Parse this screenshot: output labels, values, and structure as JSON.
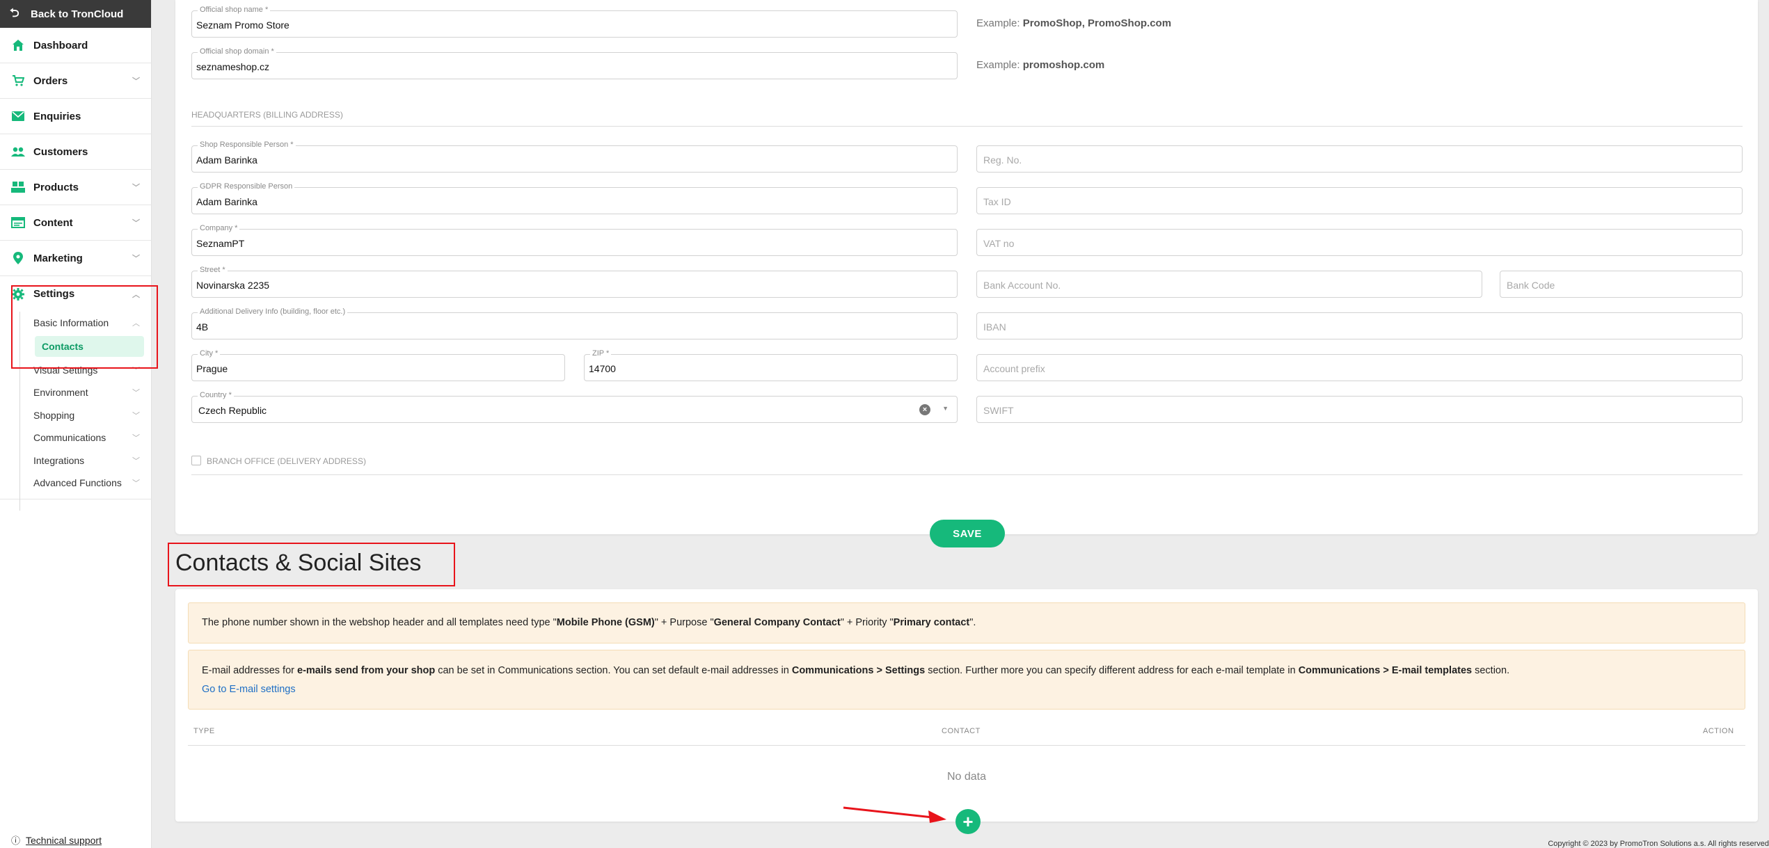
{
  "sidebar": {
    "back_label": "Back to TronCloud",
    "items": [
      {
        "label": "Dashboard",
        "icon": "home-icon"
      },
      {
        "label": "Orders",
        "icon": "cart-icon"
      },
      {
        "label": "Enquiries",
        "icon": "mail-icon"
      },
      {
        "label": "Customers",
        "icon": "users-icon"
      },
      {
        "label": "Products",
        "icon": "boxes-icon"
      },
      {
        "label": "Content",
        "icon": "layout-icon"
      },
      {
        "label": "Marketing",
        "icon": "pin-icon"
      },
      {
        "label": "Settings",
        "icon": "gear-icon"
      }
    ],
    "settings_sub": [
      {
        "label": "Basic Information"
      },
      {
        "label": "Visual Settings"
      },
      {
        "label": "Environment"
      },
      {
        "label": "Shopping"
      },
      {
        "label": "Communications"
      },
      {
        "label": "Integrations"
      },
      {
        "label": "Advanced Functions"
      }
    ],
    "active_sub": "Contacts",
    "support_label": "Technical support"
  },
  "form": {
    "shop_name": {
      "label": "Official shop name *",
      "value": "Seznam Promo Store"
    },
    "shop_name_example": {
      "prefix": "Example:",
      "value": "PromoShop, PromoShop.com"
    },
    "shop_domain": {
      "label": "Official shop domain *",
      "value": "seznameshop.cz"
    },
    "shop_domain_example": {
      "prefix": "Example:",
      "value": "promoshop.com"
    },
    "hq_section": "HEADQUARTERS (BILLING ADDRESS)",
    "responsible_person": {
      "label": "Shop Responsible Person *",
      "value": "Adam Barinka"
    },
    "gdpr_person": {
      "label": "GDPR Responsible Person",
      "value": "Adam Barinka"
    },
    "company": {
      "label": "Company *",
      "value": "SeznamPT"
    },
    "street": {
      "label": "Street *",
      "value": "Novinarska 2235"
    },
    "delivery_info": {
      "label": "Additional Delivery Info (building, floor etc.)",
      "value": "4B"
    },
    "city": {
      "label": "City *",
      "value": "Prague"
    },
    "zip": {
      "label": "ZIP *",
      "value": "14700"
    },
    "country": {
      "label": "Country *",
      "value": "Czech Republic"
    },
    "reg_no": {
      "placeholder": "Reg. No."
    },
    "tax_id": {
      "placeholder": "Tax ID"
    },
    "vat_no": {
      "placeholder": "VAT no"
    },
    "bank_account": {
      "placeholder": "Bank Account No."
    },
    "bank_code": {
      "placeholder": "Bank Code"
    },
    "iban": {
      "placeholder": "IBAN"
    },
    "account_prefix": {
      "placeholder": "Account prefix"
    },
    "swift": {
      "placeholder": "SWIFT"
    },
    "branch_office": "BRANCH OFFICE (DELIVERY ADDRESS)",
    "save_label": "SAVE"
  },
  "contacts": {
    "heading": "Contacts & Social Sites",
    "notice1": {
      "t1": "The phone number shown in the webshop header and all templates need type \"",
      "b1": "Mobile Phone (GSM)",
      "t2": "\" + Purpose \"",
      "b2": "General Company Contact",
      "t3": "\" + Priority \"",
      "b3": "Primary contact",
      "t4": "\"."
    },
    "notice2": {
      "t1": "E-mail addresses for ",
      "b1": "e-mails send from your shop",
      "t2": " can be set in Communications section. You can set default e-mail addresses in ",
      "b2": "Communications > Settings",
      "t3": " section. Further more you can specify different address for each e-mail template in ",
      "b3": "Communications > E-mail templates",
      "t4": " section.",
      "link": "Go to E-mail settings"
    },
    "columns": {
      "type": "TYPE",
      "contact": "CONTACT",
      "action": "ACTION"
    },
    "empty": "No data",
    "add_symbol": "+"
  },
  "footer": {
    "copyright": "Copyright © 2023 by PromoTron Solutions a.s. All rights reserved"
  },
  "colors": {
    "accent": "#16b97b",
    "annotation": "#e8141b",
    "notice_bg": "#fdf2e2"
  }
}
